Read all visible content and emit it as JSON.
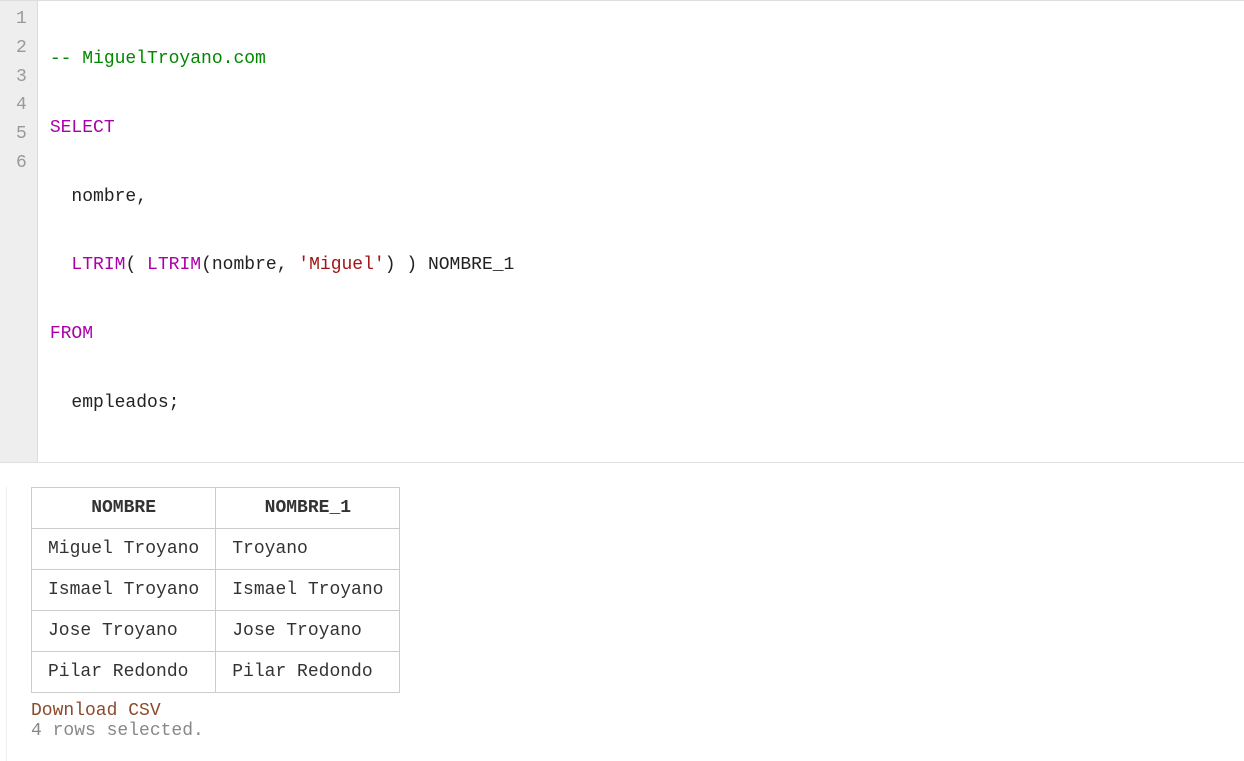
{
  "editor": {
    "line_numbers": [
      "1",
      "2",
      "3",
      "4",
      "5",
      "6"
    ],
    "lines": {
      "l1": {
        "comment": "-- MiguelTroyano.com"
      },
      "l2": {
        "kw_select": "SELECT"
      },
      "l3": {
        "indent": "  ",
        "ident": "nombre",
        "comma": ","
      },
      "l4": {
        "indent": "  ",
        "func1": "LTRIM",
        "lp1": "( ",
        "func2": "LTRIM",
        "lp2": "(",
        "arg1": "nombre",
        "comma": ", ",
        "str": "'Miguel'",
        "rp2": ")",
        "rp1": " )",
        "alias": " NOMBRE_1"
      },
      "l5": {
        "kw_from": "FROM"
      },
      "l6": {
        "indent": "  ",
        "ident": "empleados",
        "semi": ";"
      }
    }
  },
  "results": {
    "headers": [
      "NOMBRE",
      "NOMBRE_1"
    ],
    "rows": [
      {
        "c0": "Miguel Troyano",
        "c1": "Troyano"
      },
      {
        "c0": "Ismael Troyano",
        "c1": "Ismael Troyano"
      },
      {
        "c0": "Jose Troyano",
        "c1": "Jose Troyano"
      },
      {
        "c0": "Pilar Redondo",
        "c1": "Pilar Redondo"
      }
    ],
    "download_label": "Download CSV",
    "status": "4 rows selected."
  }
}
